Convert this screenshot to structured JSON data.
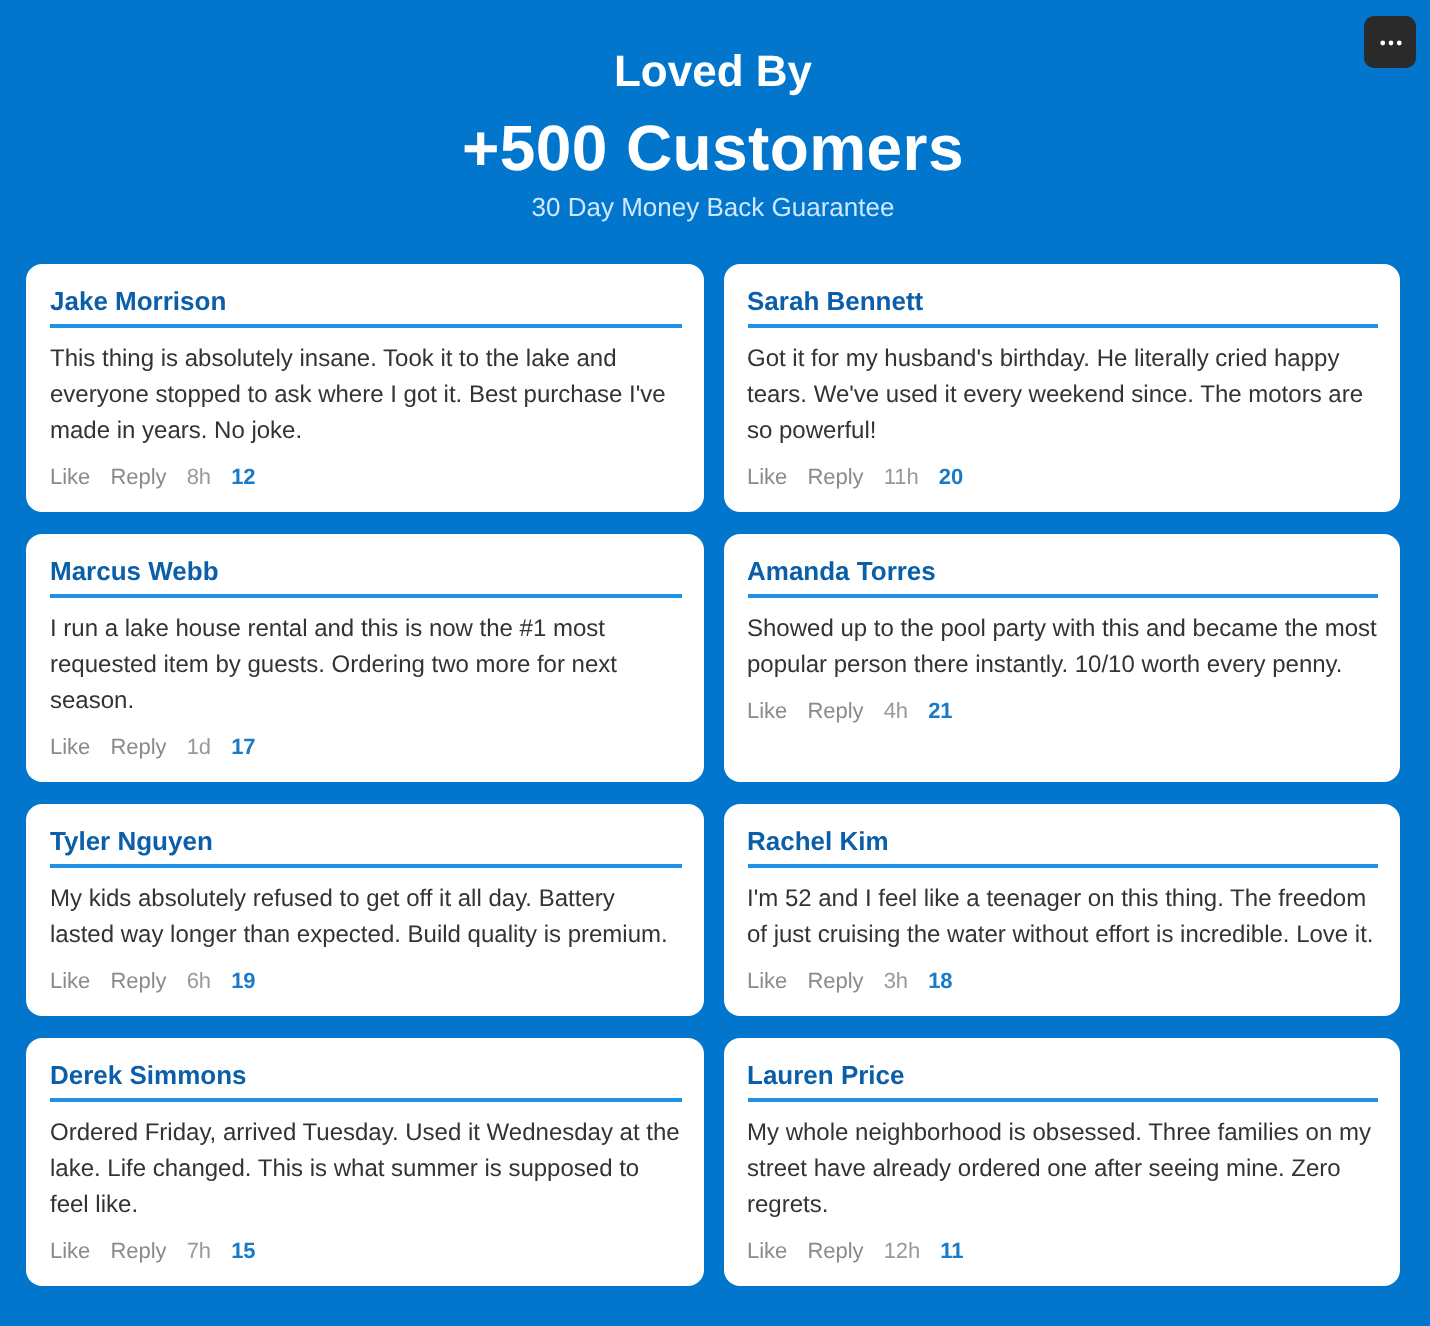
{
  "header": {
    "title": "Loved By",
    "headline": "+500 Customers",
    "subtitle": "30 Day Money Back Guarantee"
  },
  "reviews": [
    {
      "name": "Jake Morrison",
      "text": "This thing is absolutely insane. Took it to the lake and everyone stopped to ask where I got it. Best purchase I've made in years. No joke.",
      "actions": [
        "Like",
        "Reply"
      ],
      "time": "8h",
      "likes": "12"
    },
    {
      "name": "Sarah Bennett",
      "text": "Got it for my husband's birthday. He literally cried happy tears. We've used it every weekend since. The motors are so powerful!",
      "actions": [
        "Like",
        "Reply"
      ],
      "time": "11h",
      "likes": "20"
    },
    {
      "name": "Marcus Webb",
      "text": "I run a lake house rental and this is now the #1 most requested item by guests. Ordering two more for next season.",
      "actions": [
        "Like",
        "Reply"
      ],
      "time": "1d",
      "likes": "17"
    },
    {
      "name": "Amanda Torres",
      "text": "Showed up to the pool party with this and became the most popular person there instantly. 10/10 worth every penny.",
      "actions": [
        "Like",
        "Reply"
      ],
      "time": "4h",
      "likes": "21"
    },
    {
      "name": "Tyler Nguyen",
      "text": "My kids absolutely refused to get off it all day. Battery lasted way longer than expected. Build quality is premium.",
      "actions": [
        "Like",
        "Reply"
      ],
      "time": "6h",
      "likes": "19"
    },
    {
      "name": "Rachel Kim",
      "text": "I'm 52 and I feel like a teenager on this thing. The freedom of just cruising the water without effort is incredible. Love it.",
      "actions": [
        "Like",
        "Reply"
      ],
      "time": "3h",
      "likes": "18"
    },
    {
      "name": "Derek Simmons",
      "text": "Ordered Friday, arrived Tuesday. Used it Wednesday at the lake. Life changed. This is what summer is supposed to feel like.",
      "actions": [
        "Like",
        "Reply"
      ],
      "time": "7h",
      "likes": "15"
    },
    {
      "name": "Lauren Price",
      "text": "My whole neighborhood is obsessed. Three families on my street have already ordered one after seeing mine. Zero regrets.",
      "actions": [
        "Like",
        "Reply"
      ],
      "time": "12h",
      "likes": "11"
    }
  ]
}
